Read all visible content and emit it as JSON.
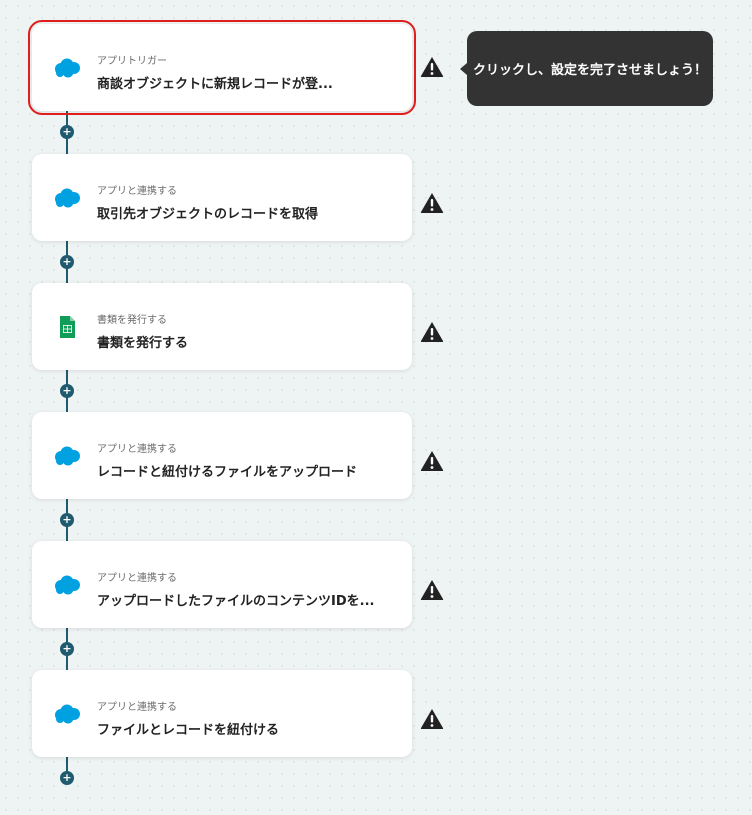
{
  "tooltip": {
    "text": "クリックし、設定を完了させましょう！"
  },
  "colors": {
    "connector": "#1f5a6e",
    "salesforce_blue": "#00a1e0",
    "sheets_green": "#0f9d58",
    "selected_outline": "#e01e1e",
    "warning": "#222222"
  },
  "steps": [
    {
      "icon": "salesforce-icon",
      "type_label": "アプリトリガー",
      "title": "商談オブジェクトに新規レコードが登...",
      "selected": true,
      "status": "warning-icon"
    },
    {
      "icon": "salesforce-icon",
      "type_label": "アプリと連携する",
      "title": "取引先オブジェクトのレコードを取得",
      "selected": false,
      "status": "warning-icon"
    },
    {
      "icon": "google-sheets-icon",
      "type_label": "書類を発行する",
      "title": "書類を発行する",
      "selected": false,
      "status": "warning-icon"
    },
    {
      "icon": "salesforce-icon",
      "type_label": "アプリと連携する",
      "title": "レコードと紐付けるファイルをアップロード",
      "selected": false,
      "status": "warning-icon"
    },
    {
      "icon": "salesforce-icon",
      "type_label": "アプリと連携する",
      "title": "アップロードしたファイルのコンテンツIDを...",
      "selected": false,
      "status": "warning-icon"
    },
    {
      "icon": "salesforce-icon",
      "type_label": "アプリと連携する",
      "title": "ファイルとレコードを紐付ける",
      "selected": false,
      "status": "warning-icon"
    }
  ]
}
